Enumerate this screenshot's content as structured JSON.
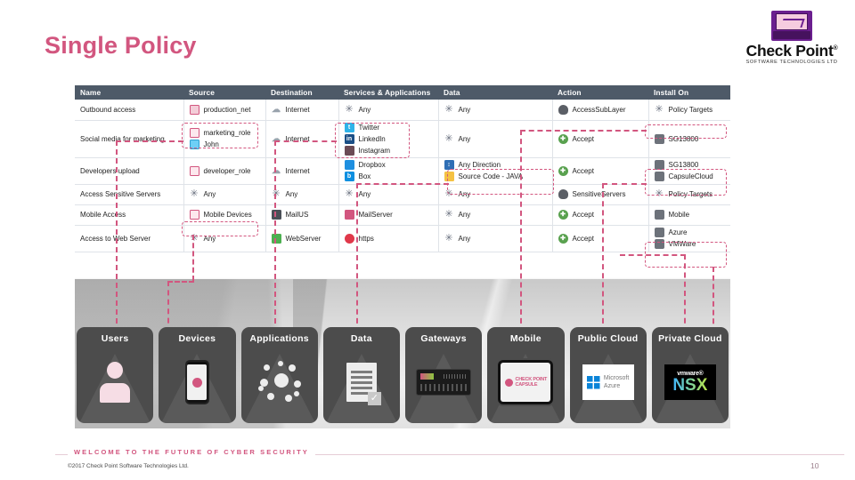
{
  "slide": {
    "title": "Single Policy",
    "page_number": "10",
    "accent_color": "#d2567f",
    "header_bg_color": "#4e5a68"
  },
  "logo": {
    "name": "Check Point",
    "registered": "®",
    "subtitle": "SOFTWARE TECHNOLOGIES LTD",
    "mark_icon": "checkpoint-computer-icon"
  },
  "table": {
    "columns": [
      "Name",
      "Source",
      "Destination",
      "Services & Applications",
      "Data",
      "Action",
      "Install On"
    ],
    "rows": [
      {
        "name": "Outbound access",
        "source": [
          {
            "icon": "network-icon",
            "label": "production_net"
          }
        ],
        "destination": [
          {
            "icon": "cloud-icon",
            "label": "Internet"
          }
        ],
        "services": [
          {
            "icon": "asterisk-icon",
            "label": "Any"
          }
        ],
        "data": [
          {
            "icon": "asterisk-icon",
            "label": "Any"
          }
        ],
        "action": [
          {
            "icon": "layer-icon",
            "label": "AccessSubLayer"
          }
        ],
        "install_on": [
          {
            "icon": "asterisk-icon",
            "label": "Policy Targets"
          }
        ]
      },
      {
        "name": "Social media for marketing",
        "source": [
          {
            "icon": "role-card-icon",
            "label": "marketing_role"
          },
          {
            "icon": "user-card-icon",
            "label": "John"
          }
        ],
        "destination": [
          {
            "icon": "cloud-icon",
            "label": "Internet"
          }
        ],
        "services": [
          {
            "icon": "twitter-icon",
            "label": "Twitter"
          },
          {
            "icon": "linkedin-icon",
            "label": "LinkedIn"
          },
          {
            "icon": "instagram-icon",
            "label": "Instagram"
          }
        ],
        "data": [
          {
            "icon": "asterisk-icon",
            "label": "Any"
          }
        ],
        "action": [
          {
            "icon": "accept-icon",
            "label": "Accept"
          }
        ],
        "install_on": [
          {
            "icon": "gateway-icon",
            "label": "SG13800"
          }
        ]
      },
      {
        "name": "Developers upload",
        "source": [
          {
            "icon": "role-card-icon",
            "label": "developer_role"
          }
        ],
        "destination": [
          {
            "icon": "cloud-icon",
            "label": "Internet"
          }
        ],
        "services": [
          {
            "icon": "dropbox-icon",
            "label": "Dropbox"
          },
          {
            "icon": "box-icon",
            "label": "Box"
          }
        ],
        "data": [
          {
            "icon": "direction-icon",
            "label": "Any Direction"
          },
          {
            "icon": "java-icon",
            "label": "Source Code - JAVA"
          }
        ],
        "action": [
          {
            "icon": "accept-icon",
            "label": "Accept"
          }
        ],
        "install_on": [
          {
            "icon": "gateway-icon",
            "label": "SG13800"
          },
          {
            "icon": "gateway-icon",
            "label": "CapsuleCloud"
          }
        ]
      },
      {
        "name": "Access Sensitive Servers",
        "source": [
          {
            "icon": "asterisk-icon",
            "label": "Any"
          }
        ],
        "destination": [
          {
            "icon": "asterisk-icon",
            "label": "Any"
          }
        ],
        "services": [
          {
            "icon": "asterisk-icon",
            "label": "Any"
          }
        ],
        "data": [
          {
            "icon": "asterisk-icon",
            "label": "Any"
          }
        ],
        "action": [
          {
            "icon": "layer-icon",
            "label": "SensitiveServers"
          }
        ],
        "install_on": [
          {
            "icon": "asterisk-icon",
            "label": "Policy Targets"
          }
        ]
      },
      {
        "name": "Mobile Access",
        "source": [
          {
            "icon": "device-card-icon",
            "label": "Mobile Devices"
          }
        ],
        "destination": [
          {
            "icon": "monitor-icon",
            "label": "MailUS"
          }
        ],
        "services": [
          {
            "icon": "mail-icon",
            "label": "MailServer"
          }
        ],
        "data": [
          {
            "icon": "asterisk-icon",
            "label": "Any"
          }
        ],
        "action": [
          {
            "icon": "accept-icon",
            "label": "Accept"
          }
        ],
        "install_on": [
          {
            "icon": "gateway-icon",
            "label": "Mobile"
          }
        ]
      },
      {
        "name": "Access to Web Server",
        "source": [
          {
            "icon": "asterisk-icon",
            "label": "Any"
          }
        ],
        "destination": [
          {
            "icon": "webserver-icon",
            "label": "WebServer"
          }
        ],
        "services": [
          {
            "icon": "https-icon",
            "label": "https"
          }
        ],
        "data": [
          {
            "icon": "asterisk-icon",
            "label": "Any"
          }
        ],
        "action": [
          {
            "icon": "accept-icon",
            "label": "Accept"
          }
        ],
        "install_on": [
          {
            "icon": "gateway-icon",
            "label": "Azure"
          },
          {
            "icon": "gateway-icon",
            "label": "VMWare"
          }
        ]
      }
    ]
  },
  "tiles": [
    {
      "label": "Users",
      "glyph": "user-silhouette-icon"
    },
    {
      "label": "Devices",
      "glyph": "smartphone-icon"
    },
    {
      "label": "Applications",
      "glyph": "applications-network-icon"
    },
    {
      "label": "Data",
      "glyph": "document-check-icon"
    },
    {
      "label": "Gateways",
      "glyph": "appliance-icon"
    },
    {
      "label": "Mobile",
      "glyph": "checkpoint-capsule-icon"
    },
    {
      "label": "Public Cloud",
      "glyph": "microsoft-azure-logo"
    },
    {
      "label": "Private Cloud",
      "glyph": "vmware-nsx-logo"
    }
  ],
  "tile_logos": {
    "azure_brand": "Microsoft",
    "azure_product": "Azure",
    "vmware_brand": "vmware®",
    "vmware_product": "NSX",
    "capsule_brand": "CHECK POINT",
    "capsule_product": "CAPSULE"
  },
  "footer": {
    "welcome": "WELCOME TO THE FUTURE OF CYBER SECURITY",
    "copyright": "©2017 Check Point Software Technologies Ltd."
  }
}
